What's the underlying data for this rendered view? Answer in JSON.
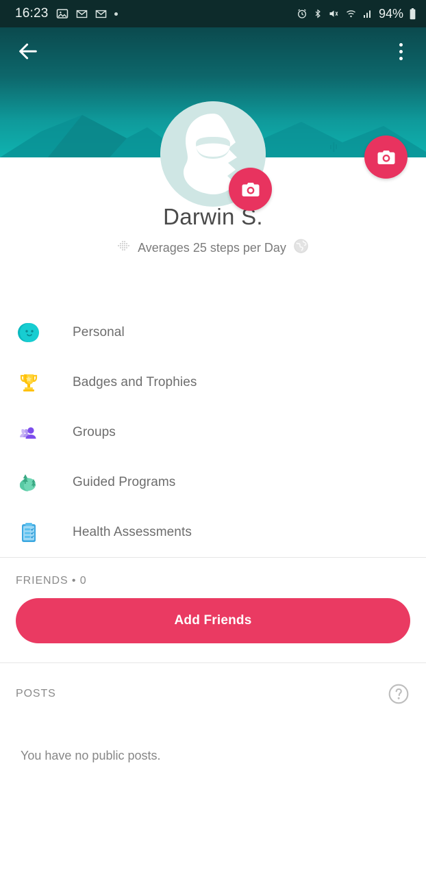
{
  "statusbar": {
    "time": "16:23",
    "battery": "94%",
    "icons_left": [
      "photo-icon",
      "gmail-icon",
      "gmail-icon",
      "dot-indicator"
    ],
    "icons_right": [
      "alarm-icon",
      "bluetooth-icon",
      "mute-vibrate-icon",
      "wifi-icon",
      "signal-icon",
      "battery-icon"
    ]
  },
  "header": {
    "back_label": "Back",
    "menu_label": "More options",
    "cover_camera_label": "Change cover photo",
    "avatar_camera_label": "Change profile photo"
  },
  "profile": {
    "name": "Darwin S.",
    "stat_text": "Averages 25 steps per Day",
    "steps_average": 25,
    "privacy_icon": "globe-icon",
    "steps_icon": "steps-dots-icon"
  },
  "menu": {
    "items": [
      {
        "label": "Personal",
        "icon": "smiley-face-icon"
      },
      {
        "label": "Badges and Trophies",
        "icon": "trophy-icon"
      },
      {
        "label": "Groups",
        "icon": "people-group-icon"
      },
      {
        "label": "Guided Programs",
        "icon": "hill-trees-icon"
      },
      {
        "label": "Health Assessments",
        "icon": "clipboard-checklist-icon"
      }
    ]
  },
  "friends": {
    "section_label": "FRIENDS • 0",
    "count": 0,
    "add_button": "Add Friends"
  },
  "posts": {
    "section_label": "POSTS",
    "help_icon": "question-mark-circle-icon",
    "empty_text": "You have no public posts."
  },
  "colors": {
    "accent_pink": "#ea3a62",
    "cover_teal_dark": "#0b4a4e",
    "cover_teal_light": "#0fb3b0",
    "text_gray": "#6d6d6d"
  }
}
